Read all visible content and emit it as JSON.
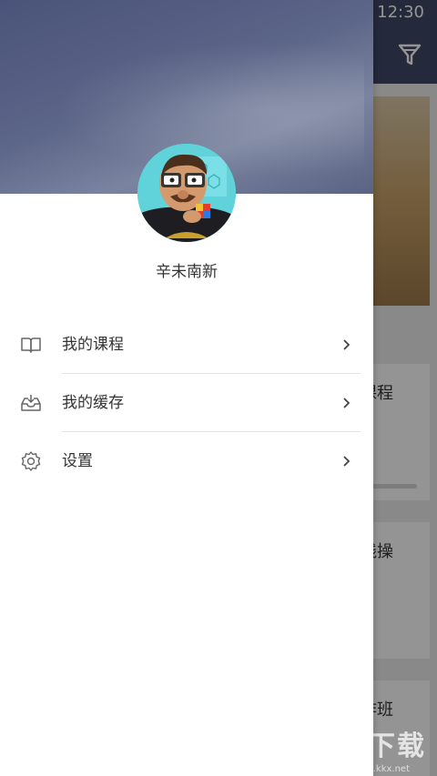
{
  "status_bar": {
    "time": "12:30"
  },
  "background": {
    "cards": [
      {
        "text": "课程"
      },
      {
        "text": "践操"
      },
      {
        "text": "作班"
      }
    ],
    "watermark": "KK下载",
    "watermark_sub": "www.kkx.net"
  },
  "drawer": {
    "username": "辛未南新",
    "menu": [
      {
        "label": "我的课程",
        "icon": "book-icon"
      },
      {
        "label": "我的缓存",
        "icon": "download-tray-icon"
      },
      {
        "label": "设置",
        "icon": "gear-icon"
      }
    ]
  },
  "colors": {
    "header": "#4a5379",
    "topbar": "#3e4766",
    "text": "#333333",
    "divider": "#e6e6e6"
  }
}
